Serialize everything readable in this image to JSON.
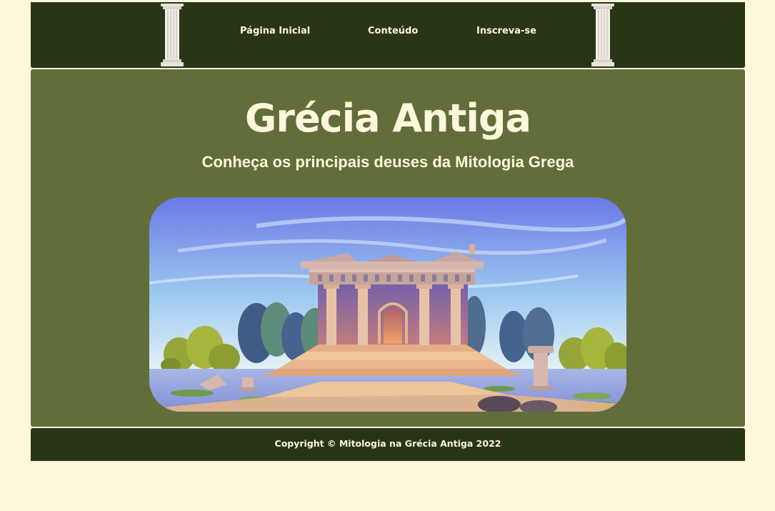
{
  "nav": {
    "items": [
      {
        "label": "Página Inicial"
      },
      {
        "label": "Conteúdo"
      },
      {
        "label": "Inscreva-se"
      }
    ]
  },
  "main": {
    "title": "Grécia Antiga",
    "subtitle": "Conheça os principais deuses da Mitologia Grega"
  },
  "footer": {
    "copyright": "Copyright © Mitologia na Grécia Antiga 2022"
  },
  "colors": {
    "page_background": "#fdf7dc",
    "header_footer": "#283617",
    "main_panel": "#626e39",
    "text": "#fdf7dc"
  },
  "icons": {
    "header_decoration": "greek-column-icon",
    "hero": "ancient-greek-temple-illustration"
  }
}
